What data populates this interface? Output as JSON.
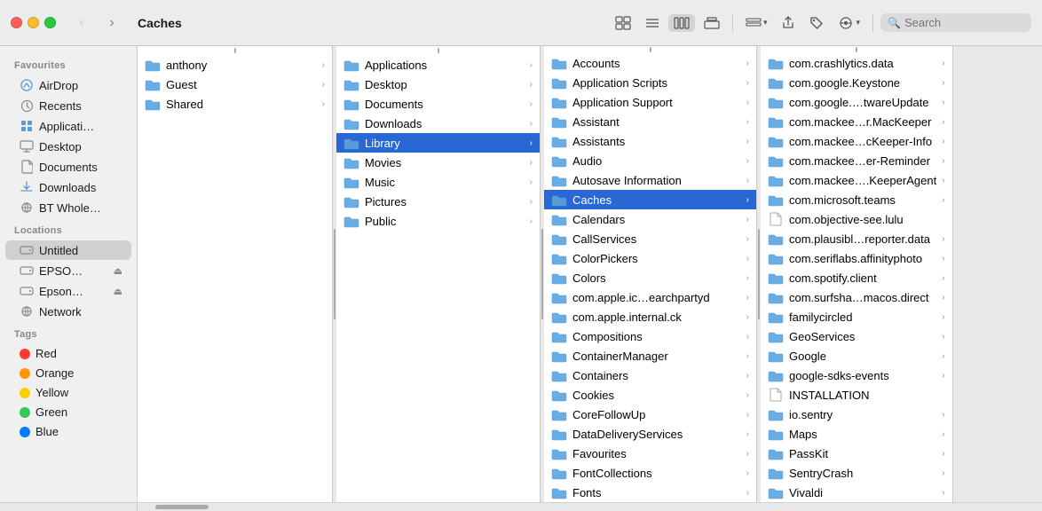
{
  "window": {
    "title": "Caches"
  },
  "toolbar": {
    "back_label": "‹",
    "forward_label": "›",
    "view_icon_grid": "⊞",
    "view_icon_list": "☰",
    "view_icon_col": "▤",
    "view_icon_gallery": "▥",
    "share_icon": "↑",
    "tag_icon": "🏷",
    "action_icon": "☺",
    "search_placeholder": "Search"
  },
  "sidebar": {
    "favourites_label": "Favourites",
    "items_favourites": [
      {
        "id": "airdrop",
        "label": "AirDrop",
        "icon": "airdrop"
      },
      {
        "id": "recents",
        "label": "Recents",
        "icon": "clock"
      },
      {
        "id": "applications",
        "label": "Applicati…",
        "icon": "apps"
      },
      {
        "id": "desktop",
        "label": "Desktop",
        "icon": "desktop"
      },
      {
        "id": "documents",
        "label": "Documents",
        "icon": "doc"
      },
      {
        "id": "downloads",
        "label": "Downloads",
        "icon": "download"
      },
      {
        "id": "btwhole",
        "label": "BT Whole…",
        "icon": "network"
      }
    ],
    "locations_label": "Locations",
    "items_locations": [
      {
        "id": "untitled",
        "label": "Untitled",
        "icon": "drive",
        "selected": true
      },
      {
        "id": "epso1",
        "label": "EPSO…",
        "icon": "drive",
        "eject": true
      },
      {
        "id": "epson2",
        "label": "Epson…",
        "icon": "drive",
        "eject": true
      },
      {
        "id": "network",
        "label": "Network",
        "icon": "network"
      }
    ],
    "tags_label": "Tags",
    "items_tags": [
      {
        "id": "red",
        "label": "Red",
        "color": "#ff3b30"
      },
      {
        "id": "orange",
        "label": "Orange",
        "color": "#ff9500"
      },
      {
        "id": "yellow",
        "label": "Yellow",
        "color": "#ffcc00"
      },
      {
        "id": "green",
        "label": "Green",
        "color": "#34c759"
      },
      {
        "id": "blue",
        "label": "Blue",
        "color": "#007aff"
      }
    ]
  },
  "col1": {
    "items": [
      {
        "label": "anthony",
        "hasArrow": true,
        "selected": false,
        "type": "folder"
      },
      {
        "label": "Guest",
        "hasArrow": true,
        "selected": false,
        "type": "folder"
      },
      {
        "label": "Shared",
        "hasArrow": true,
        "selected": false,
        "type": "folder"
      }
    ]
  },
  "col2": {
    "items": [
      {
        "label": "Applications",
        "hasArrow": true,
        "type": "folder"
      },
      {
        "label": "Desktop",
        "hasArrow": true,
        "type": "folder"
      },
      {
        "label": "Documents",
        "hasArrow": true,
        "type": "folder"
      },
      {
        "label": "Downloads",
        "hasArrow": true,
        "type": "folder"
      },
      {
        "label": "Library",
        "hasArrow": true,
        "type": "folder",
        "selected": true
      },
      {
        "label": "Movies",
        "hasArrow": true,
        "type": "folder"
      },
      {
        "label": "Music",
        "hasArrow": true,
        "type": "folder"
      },
      {
        "label": "Pictures",
        "hasArrow": true,
        "type": "folder"
      },
      {
        "label": "Public",
        "hasArrow": true,
        "type": "folder"
      }
    ]
  },
  "col3": {
    "items": [
      {
        "label": "Accounts",
        "hasArrow": true,
        "type": "folder"
      },
      {
        "label": "Application Scripts",
        "hasArrow": true,
        "type": "folder"
      },
      {
        "label": "Application Support",
        "hasArrow": true,
        "type": "folder"
      },
      {
        "label": "Assistant",
        "hasArrow": true,
        "type": "folder"
      },
      {
        "label": "Assistants",
        "hasArrow": true,
        "type": "folder"
      },
      {
        "label": "Audio",
        "hasArrow": true,
        "type": "folder"
      },
      {
        "label": "Autosave Information",
        "hasArrow": true,
        "type": "folder"
      },
      {
        "label": "Caches",
        "hasArrow": true,
        "type": "folder",
        "selected": true
      },
      {
        "label": "Calendars",
        "hasArrow": true,
        "type": "folder"
      },
      {
        "label": "CallServices",
        "hasArrow": true,
        "type": "folder"
      },
      {
        "label": "ColorPickers",
        "hasArrow": true,
        "type": "folder"
      },
      {
        "label": "Colors",
        "hasArrow": true,
        "type": "folder"
      },
      {
        "label": "com.apple.ic…earchpartyd",
        "hasArrow": true,
        "type": "folder"
      },
      {
        "label": "com.apple.internal.ck",
        "hasArrow": true,
        "type": "folder"
      },
      {
        "label": "Compositions",
        "hasArrow": true,
        "type": "folder"
      },
      {
        "label": "ContainerManager",
        "hasArrow": true,
        "type": "folder"
      },
      {
        "label": "Containers",
        "hasArrow": true,
        "type": "folder"
      },
      {
        "label": "Cookies",
        "hasArrow": true,
        "type": "folder"
      },
      {
        "label": "CoreFollowUp",
        "hasArrow": true,
        "type": "folder"
      },
      {
        "label": "DataDeliveryServices",
        "hasArrow": true,
        "type": "folder"
      },
      {
        "label": "Favourites",
        "hasArrow": true,
        "type": "folder"
      },
      {
        "label": "FontCollections",
        "hasArrow": true,
        "type": "folder"
      },
      {
        "label": "Fonts",
        "hasArrow": true,
        "type": "folder"
      }
    ]
  },
  "col4": {
    "items": [
      {
        "label": "com.crashlytics.data",
        "hasArrow": true,
        "type": "folder"
      },
      {
        "label": "com.google.Keystone",
        "hasArrow": true,
        "type": "folder"
      },
      {
        "label": "com.google.…twareUpdate",
        "hasArrow": true,
        "type": "folder"
      },
      {
        "label": "com.mackee…r.MacKeeper",
        "hasArrow": true,
        "type": "folder"
      },
      {
        "label": "com.mackee…cKeeper-Info",
        "hasArrow": true,
        "type": "folder"
      },
      {
        "label": "com.mackee…er-Reminder",
        "hasArrow": true,
        "type": "folder"
      },
      {
        "label": "com.mackee….KeeperAgent",
        "hasArrow": true,
        "type": "folder"
      },
      {
        "label": "com.microsoft.teams",
        "hasArrow": true,
        "type": "folder"
      },
      {
        "label": "com.objective-see.lulu",
        "hasArrow": true,
        "type": "file"
      },
      {
        "label": "com.plausibl…reporter.data",
        "hasArrow": true,
        "type": "folder"
      },
      {
        "label": "com.seriflabs.affinityphoto",
        "hasArrow": true,
        "type": "folder"
      },
      {
        "label": "com.spotify.client",
        "hasArrow": true,
        "type": "folder"
      },
      {
        "label": "com.surfsha…macos.direct",
        "hasArrow": true,
        "type": "folder"
      },
      {
        "label": "familycircled",
        "hasArrow": true,
        "type": "folder"
      },
      {
        "label": "GeoServices",
        "hasArrow": true,
        "type": "folder"
      },
      {
        "label": "Google",
        "hasArrow": true,
        "type": "folder"
      },
      {
        "label": "google-sdks-events",
        "hasArrow": true,
        "type": "folder"
      },
      {
        "label": "INSTALLATION",
        "hasArrow": false,
        "type": "file"
      },
      {
        "label": "io.sentry",
        "hasArrow": true,
        "type": "folder"
      },
      {
        "label": "Maps",
        "hasArrow": true,
        "type": "folder"
      },
      {
        "label": "PassKit",
        "hasArrow": true,
        "type": "folder"
      },
      {
        "label": "SentryCrash",
        "hasArrow": true,
        "type": "folder"
      },
      {
        "label": "Vivaldi",
        "hasArrow": true,
        "type": "folder"
      }
    ]
  }
}
